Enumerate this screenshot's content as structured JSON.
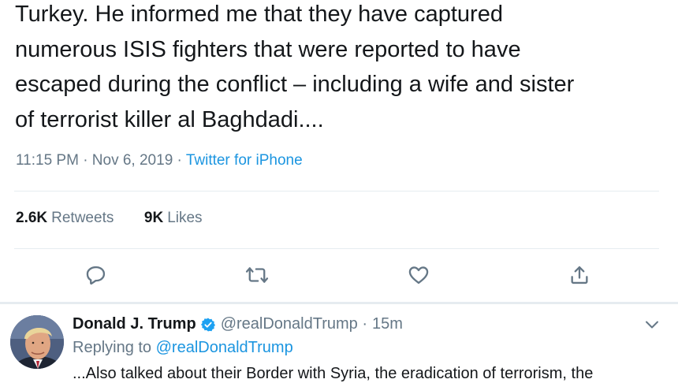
{
  "tweet": {
    "lines": [
      "Turkey. He informed me that they have captured",
      "numerous ISIS fighters that were reported to have",
      "escaped during the conflict – including a wife and sister",
      "of terrorist killer al Baghdadi...."
    ],
    "timestamp": "11:15 PM · Nov 6, 2019 ·",
    "source": "Twitter for iPhone",
    "retweets_count": "2.6K",
    "retweets_label": "Retweets",
    "likes_count": "9K",
    "likes_label": "Likes"
  },
  "actions": {
    "icons": [
      "reply-icon",
      "retweet-icon",
      "like-icon",
      "share-icon"
    ]
  },
  "reply": {
    "name": "Donald J. Trump",
    "handle": "@realDonaldTrump ·",
    "time": "15m",
    "replying_prefix": "Replying to",
    "replying_to": "@realDonaldTrump",
    "text": "...Also talked about their Border with Syria, the eradication of terrorism, the"
  },
  "colors": {
    "text": "#14171a",
    "secondary": "#657786",
    "link": "#1b95e0",
    "divider": "#e6ecf0",
    "verified": "#1da1f2"
  }
}
